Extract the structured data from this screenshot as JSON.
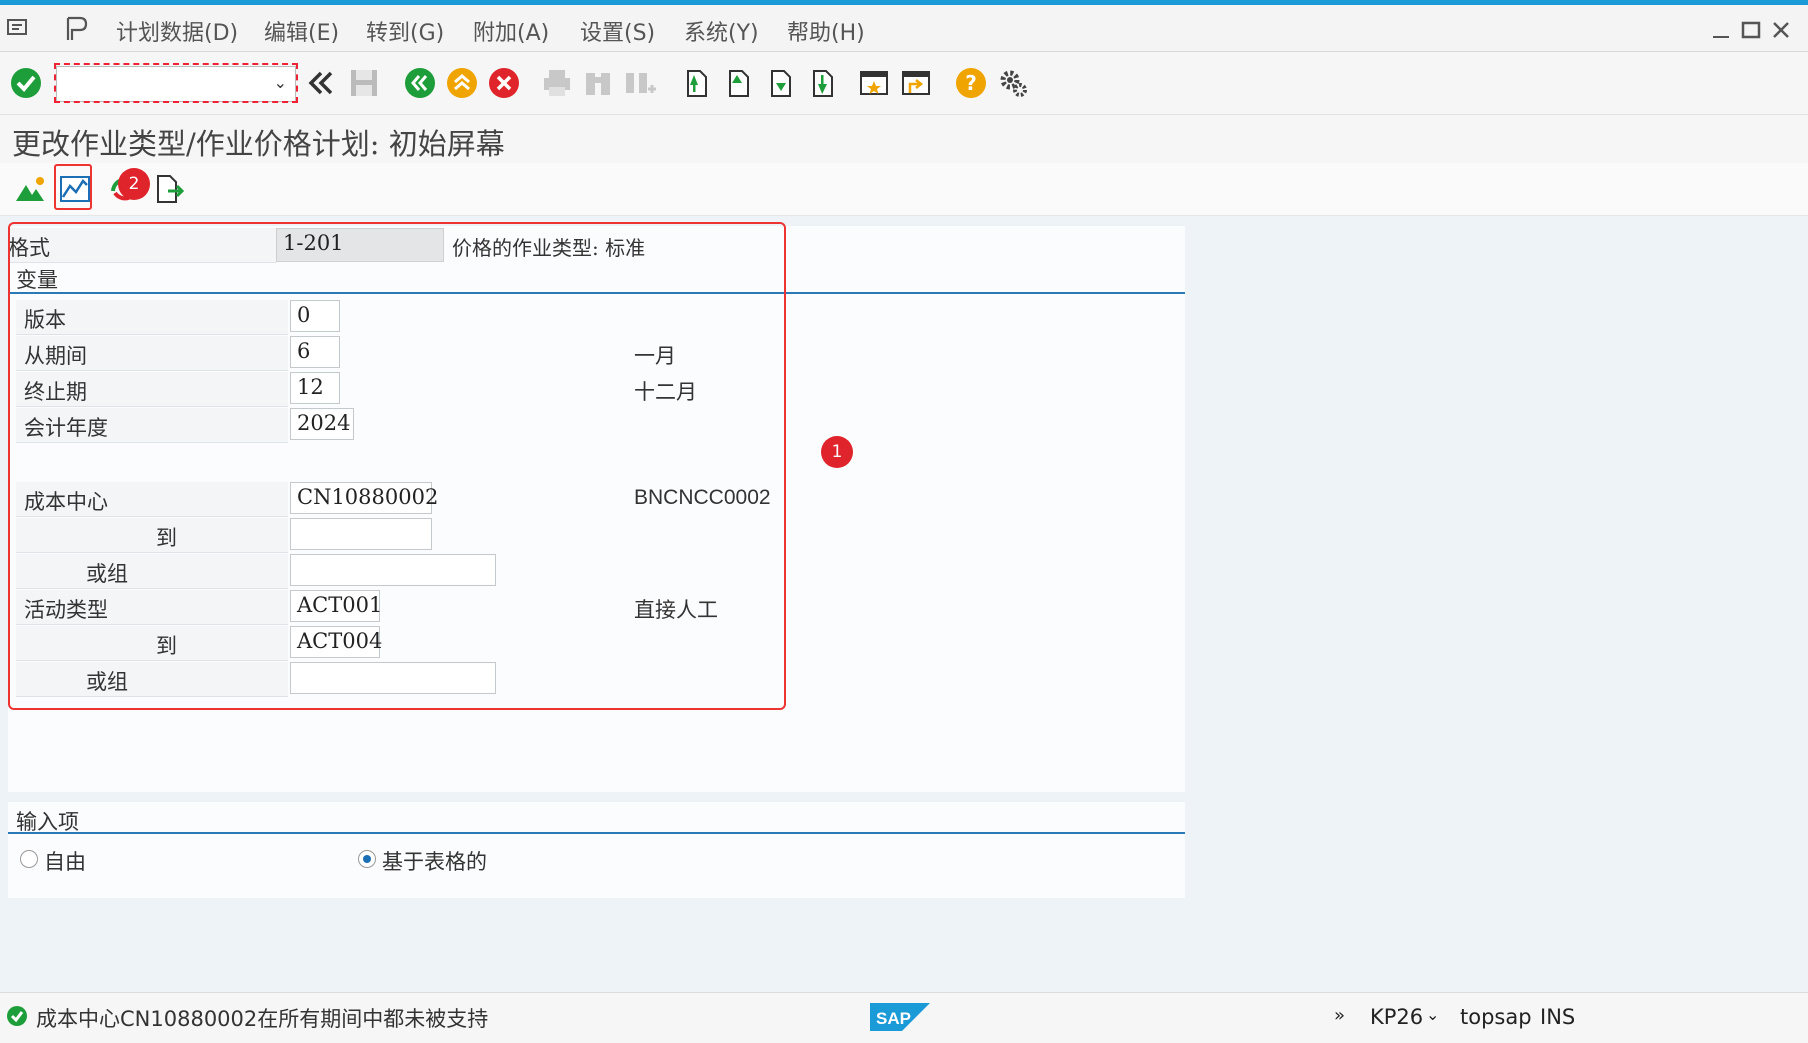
{
  "menu": {
    "items": [
      "计划数据(D)",
      "编辑(E)",
      "转到(G)",
      "附加(A)",
      "设置(S)",
      "系统(Y)",
      "帮助(H)"
    ]
  },
  "toolbar": {
    "command_value": "",
    "icons": [
      "enter-icon",
      "back-icon",
      "exit-icon",
      "cancel-icon",
      "save-icon",
      "print-icon",
      "find-icon",
      "find-next-icon",
      "first-page-icon",
      "previous-page-icon",
      "next-page-icon",
      "last-page-icon",
      "create-session-icon",
      "shortcut-icon",
      "help-icon",
      "settings-icon"
    ]
  },
  "title": "更改作业类型/作业价格计划: 初始屏幕",
  "annotations": {
    "badge1": "1",
    "badge2": "2"
  },
  "layout_row": {
    "label": "格式",
    "value": "1-201",
    "description": "价格的作业类型: 标准"
  },
  "variables_section": {
    "title": "变量",
    "fields": [
      {
        "label": "版本",
        "value": "0",
        "description": ""
      },
      {
        "label": "从期间",
        "value": "6",
        "description": "一月"
      },
      {
        "label": "终止期",
        "value": "12",
        "description": "十二月"
      },
      {
        "label": "会计年度",
        "value": "2024",
        "description": ""
      },
      {
        "label": "成本中心",
        "value": "CN10880002",
        "description": "BNCNCC0002"
      },
      {
        "label": "到",
        "value": "",
        "description": ""
      },
      {
        "label": "或组",
        "value": "",
        "description": ""
      },
      {
        "label": "活动类型",
        "value": "ACT001",
        "description": "直接人工"
      },
      {
        "label": "到",
        "value": "ACT004",
        "description": ""
      },
      {
        "label": "或组",
        "value": "",
        "description": ""
      }
    ]
  },
  "input_section": {
    "title": "输入项",
    "options": [
      {
        "label": "自由",
        "selected": false
      },
      {
        "label": "基于表格的",
        "selected": true
      }
    ]
  },
  "status": {
    "message": "成本中心CN10880002在所有期间中都未被支持",
    "brand": "SAP",
    "transaction": "KP26",
    "server": "topsap",
    "mode": "INS"
  },
  "colors": {
    "accent": "#1a9ad6",
    "section_line": "#2a7ab8",
    "annotation_red": "#e0242b",
    "ok_green": "#1e9e3a",
    "warn_orange": "#f0a400"
  }
}
